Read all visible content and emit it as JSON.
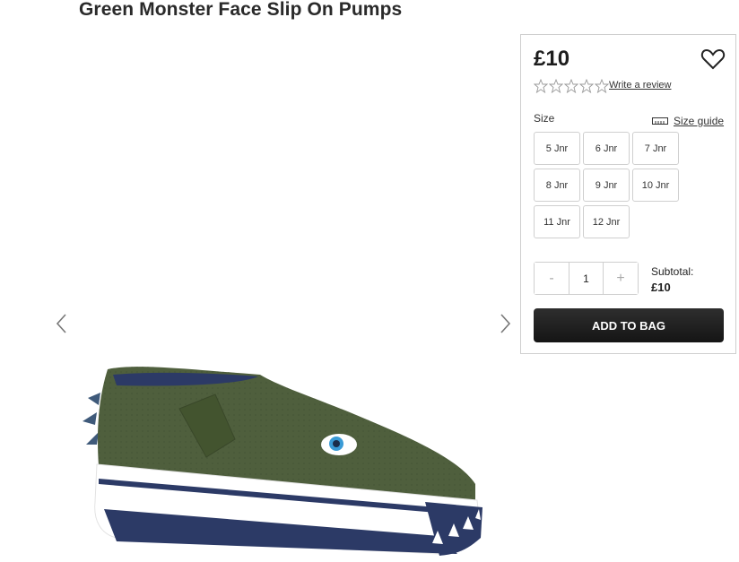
{
  "product": {
    "title": "Green Monster Face Slip On Pumps",
    "price": "£10",
    "review_link": "Write a review",
    "rating_stars": 0
  },
  "icons": {
    "prev": "chevron-left-icon",
    "next": "chevron-right-icon",
    "wishlist": "heart-icon",
    "size_guide": "ruler-icon",
    "star": "star-outline-icon"
  },
  "size": {
    "label": "Size",
    "guide_label": "Size guide",
    "options": [
      "5 Jnr",
      "6 Jnr",
      "7 Jnr",
      "8 Jnr",
      "9 Jnr",
      "10 Jnr",
      "11 Jnr",
      "12 Jnr"
    ]
  },
  "quantity": {
    "minus": "-",
    "value": "1",
    "plus": "+"
  },
  "subtotal": {
    "label": "Subtotal:",
    "value": "£10"
  },
  "cart": {
    "add_label": "ADD TO BAG"
  },
  "colors": {
    "shoe_green": "#4f5f3d",
    "sole_navy": "#2c3a66",
    "button_dark": "#1f1f1f"
  }
}
